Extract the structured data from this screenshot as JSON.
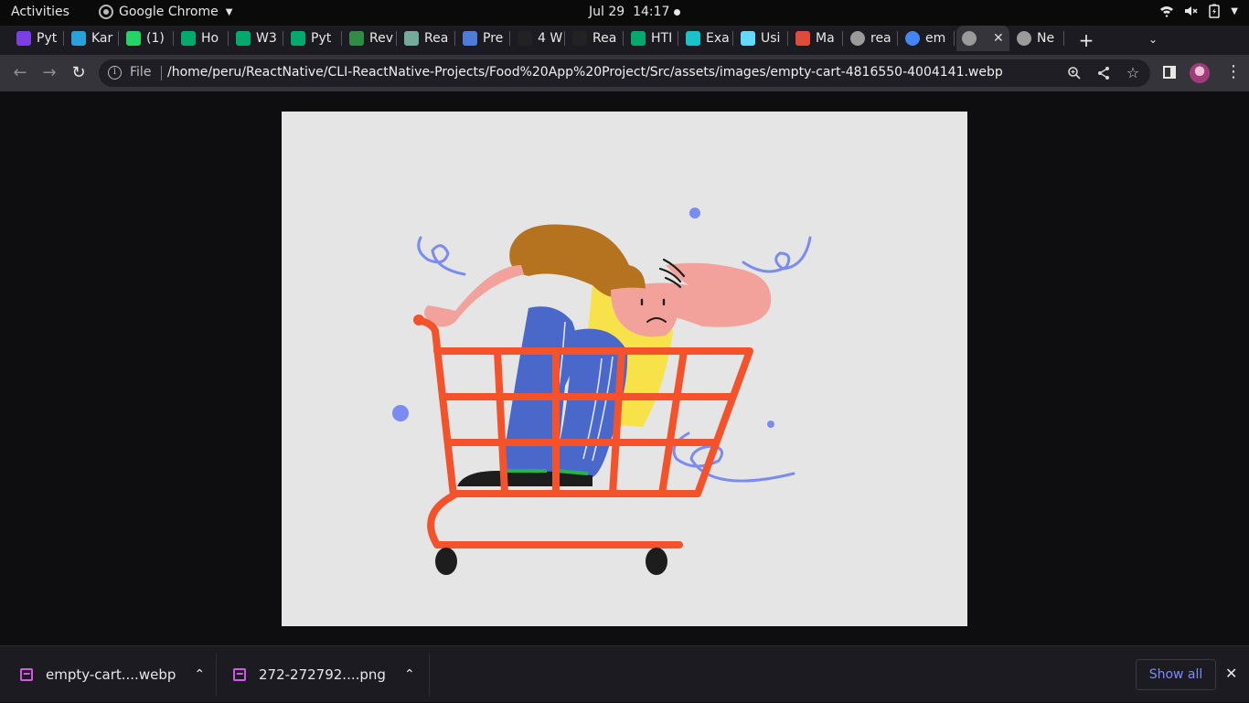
{
  "system_bar": {
    "activities": "Activities",
    "app_name": "Google Chrome",
    "date": "Jul 29",
    "time": "14:17"
  },
  "tabs": [
    {
      "label": "Pyt",
      "favicon": "pycharm-icon",
      "color": "#7b3fe4"
    },
    {
      "label": "Kar",
      "favicon": "telegram-icon",
      "color": "#2aa1da"
    },
    {
      "label": "(1)",
      "favicon": "whatsapp-icon",
      "color": "#25d366"
    },
    {
      "label": "Ho",
      "favicon": "w3schools-icon",
      "color": "#04aa6d"
    },
    {
      "label": "W3",
      "favicon": "w3schools-icon",
      "color": "#04aa6d"
    },
    {
      "label": "Pyt",
      "favicon": "w3schools-icon",
      "color": "#04aa6d"
    },
    {
      "label": "Rev",
      "favicon": "geeks-icon",
      "color": "#2f8d46"
    },
    {
      "label": "Rea",
      "favicon": "chatgpt-icon",
      "color": "#74aa9c"
    },
    {
      "label": "Pre",
      "favicon": "puzzle-icon",
      "color": "#4f7bd9"
    },
    {
      "label": "4 W",
      "favicon": "medium-icon",
      "color": "#222222"
    },
    {
      "label": "Rea",
      "favicon": "medium-icon",
      "color": "#222222"
    },
    {
      "label": "HTI",
      "favicon": "w3schools-icon",
      "color": "#04aa6d"
    },
    {
      "label": "Exa",
      "favicon": "expo-icon",
      "color": "#19c3c7"
    },
    {
      "label": "Usi",
      "favicon": "react-icon",
      "color": "#61dafb"
    },
    {
      "label": "Ma",
      "favicon": "zb-icon",
      "color": "#e14b3b"
    },
    {
      "label": "rea",
      "favicon": "globe-icon",
      "color": "#9a9a9a"
    },
    {
      "label": "em",
      "favicon": "google-icon",
      "color": "#4285f4"
    },
    {
      "label": "",
      "favicon": "globe-icon",
      "color": "#9a9a9a",
      "active": true
    },
    {
      "label": "Ne",
      "favicon": "chrome-icon",
      "color": "#9a9a9a"
    }
  ],
  "address_bar": {
    "scheme_label": "File",
    "url": "/home/peru/ReactNative/CLI-ReactNative-Projects/Food%20App%20Project/Src/assets/images/empty-cart-4816550-4004141.webp"
  },
  "colors": {
    "cart": "#f4522b",
    "hair": "#b5731f",
    "skin": "#f2a29b",
    "jeans": "#4a68c9",
    "shirt": "#f7e24a",
    "squiggle": "#7a8cf0",
    "accent_yellow": "#f5d90a",
    "accent_purple": "#c117d9",
    "accent_red": "#e81c37"
  },
  "downloads": [
    {
      "name": "empty-cart....webp"
    },
    {
      "name": "272-272792....png"
    }
  ],
  "shelf": {
    "show_all": "Show all"
  }
}
